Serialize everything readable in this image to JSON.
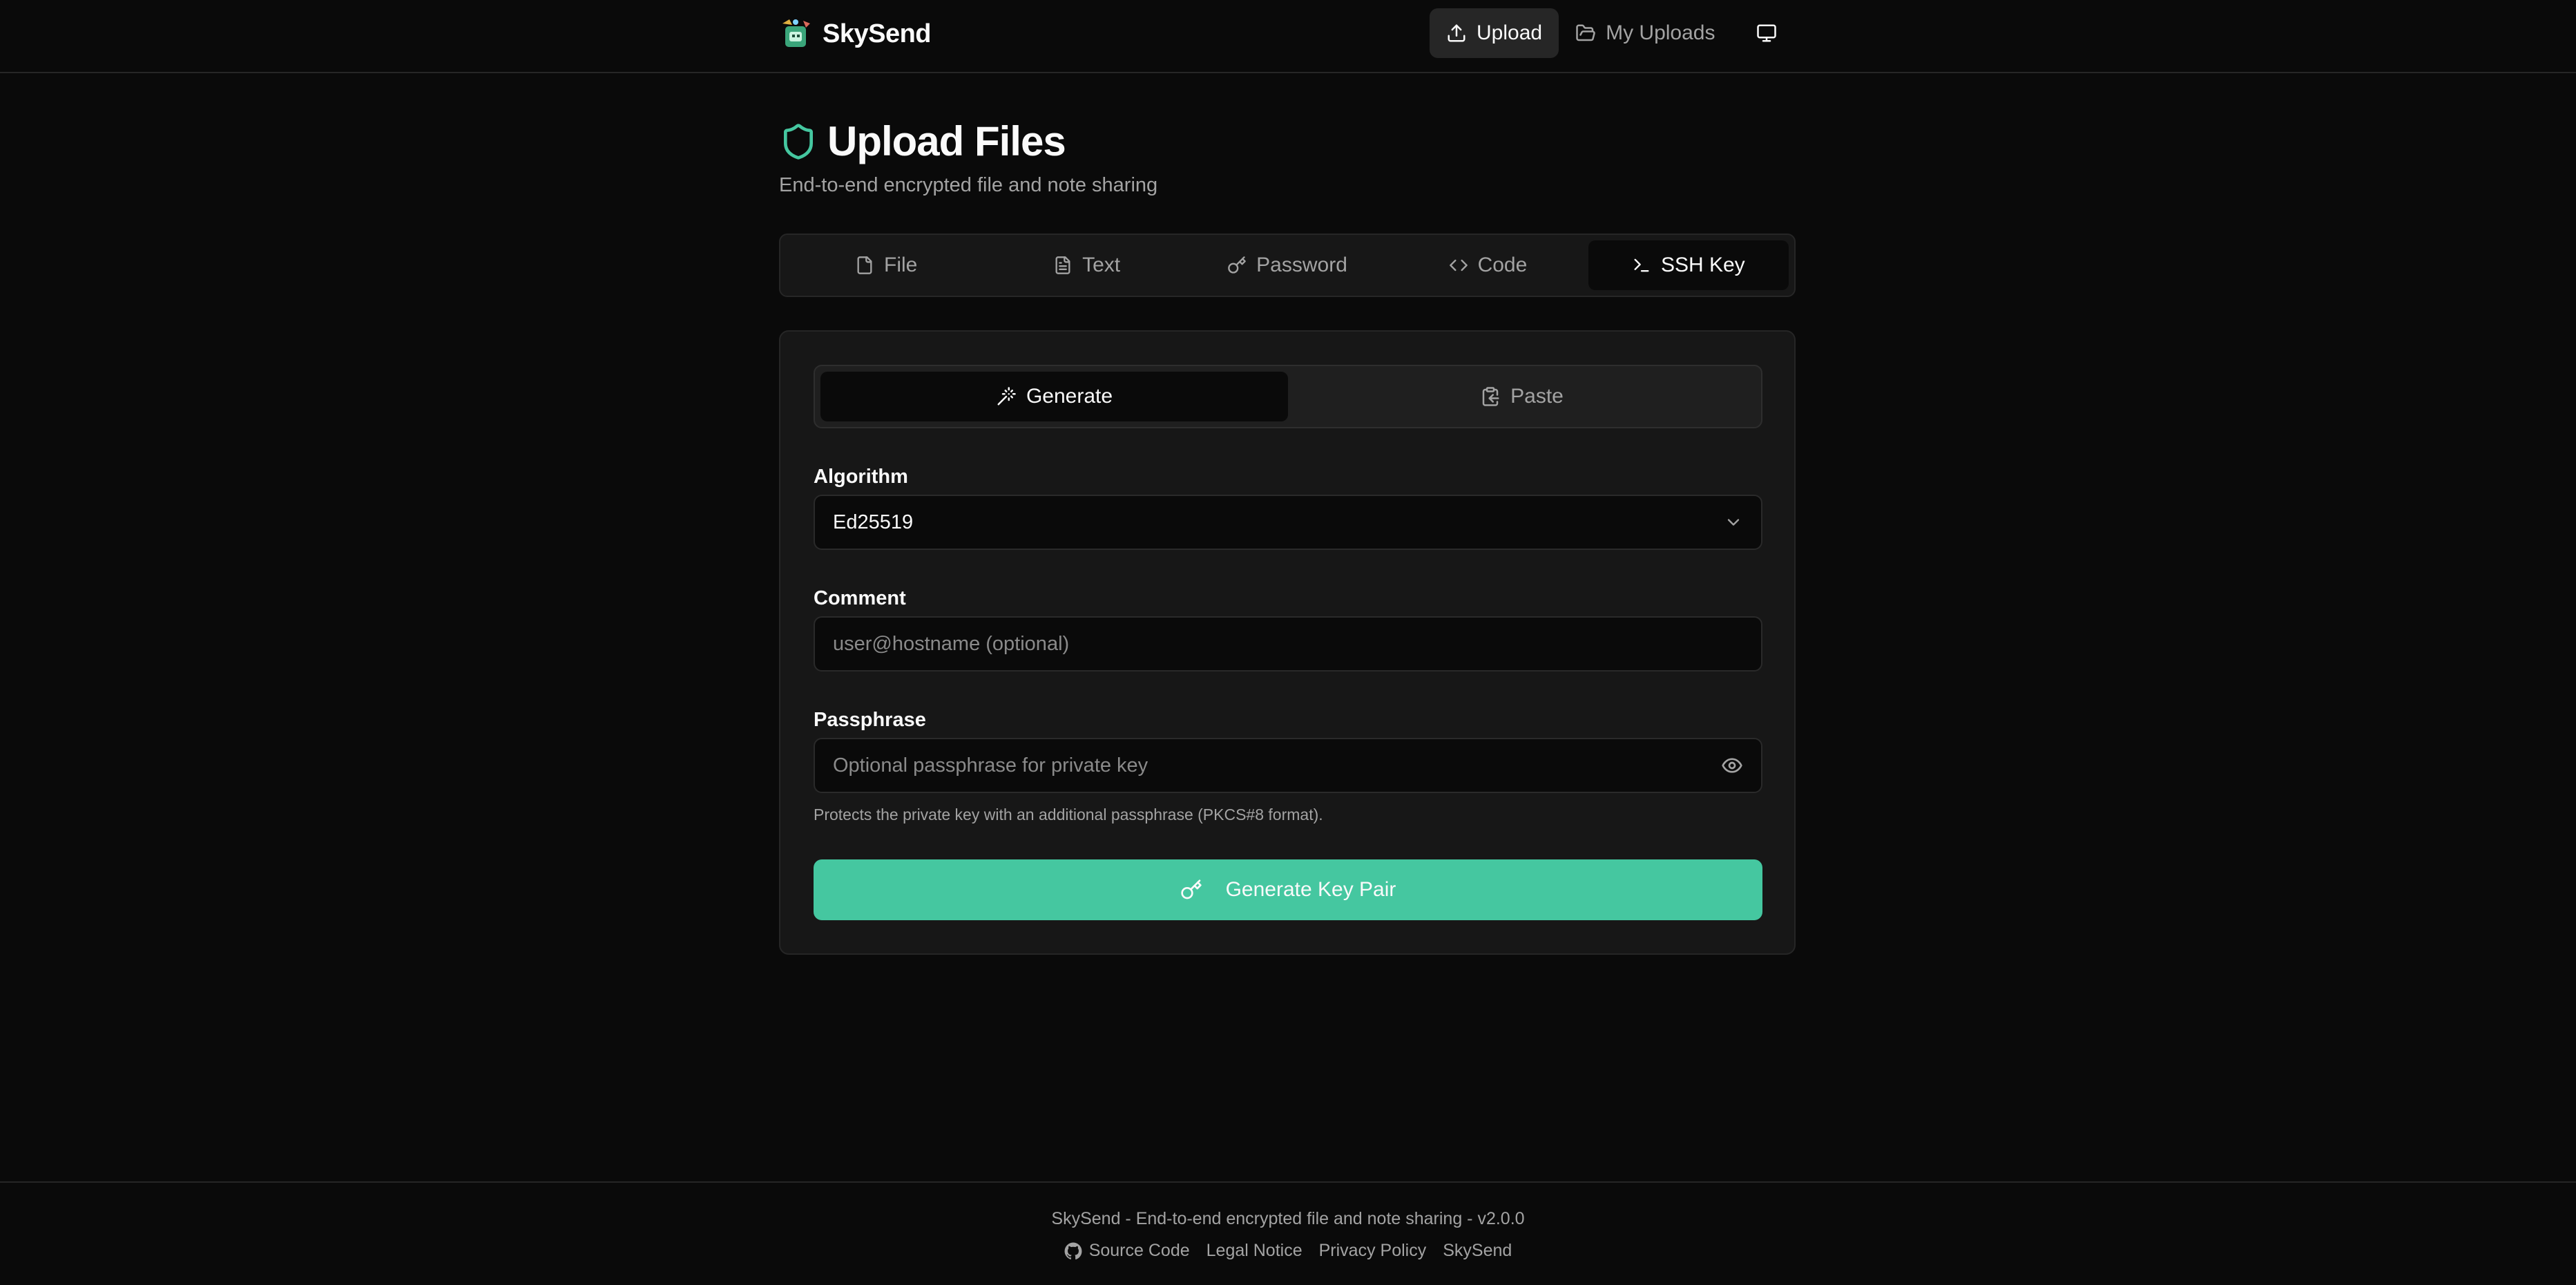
{
  "header": {
    "brand": "SkySend",
    "nav": [
      {
        "label": "Upload",
        "icon": "upload-icon",
        "active": true
      },
      {
        "label": "My Uploads",
        "icon": "folder-open-icon",
        "active": false
      }
    ],
    "display_icon": "monitor-icon"
  },
  "page": {
    "title": "Upload Files",
    "subtitle": "End-to-end encrypted file and note sharing"
  },
  "tabs": [
    {
      "label": "File",
      "icon": "file-icon"
    },
    {
      "label": "Text",
      "icon": "file-text-icon"
    },
    {
      "label": "Password",
      "icon": "key-icon"
    },
    {
      "label": "Code",
      "icon": "code-icon"
    },
    {
      "label": "SSH Key",
      "icon": "terminal-icon",
      "active": true
    }
  ],
  "mode_tabs": [
    {
      "label": "Generate",
      "icon": "wand-icon",
      "active": true
    },
    {
      "label": "Paste",
      "icon": "clipboard-icon"
    }
  ],
  "form": {
    "algorithm_label": "Algorithm",
    "algorithm_value": "Ed25519",
    "comment_label": "Comment",
    "comment_placeholder": "user@hostname (optional)",
    "passphrase_label": "Passphrase",
    "passphrase_placeholder": "Optional passphrase for private key",
    "passphrase_help": "Protects the private key with an additional passphrase (PKCS#8 format).",
    "submit_label": "Generate Key Pair"
  },
  "footer": {
    "tagline": "SkySend - End-to-end encrypted file and note sharing - v2.0.0",
    "links": [
      "Source Code",
      "Legal Notice",
      "Privacy Policy",
      "SkySend"
    ]
  },
  "colors": {
    "background": "#0a0a0a",
    "card": "#171717",
    "accent": "#45c7a0",
    "muted_text": "#a3a3a3"
  }
}
